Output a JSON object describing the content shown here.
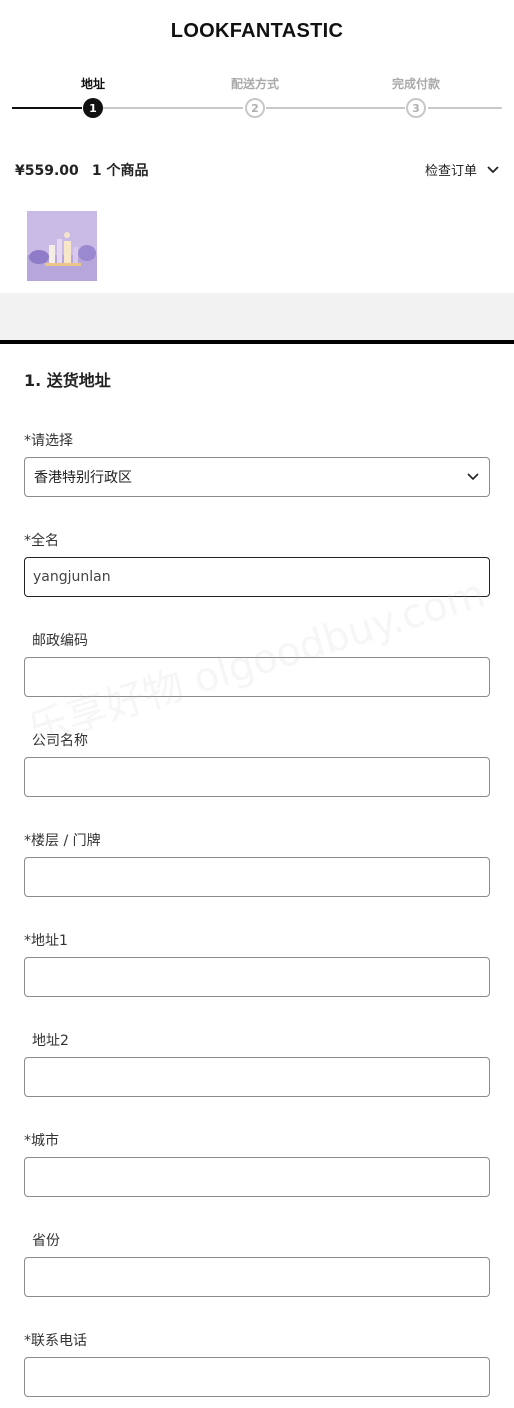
{
  "brand": "LOOKFANTASTIC",
  "steps": [
    {
      "label": "地址",
      "number": "1"
    },
    {
      "label": "配送方式",
      "number": "2"
    },
    {
      "label": "完成付款",
      "number": "3"
    }
  ],
  "summary": {
    "price": "¥559.00",
    "count": "1 个商品",
    "review_label": "检查订单"
  },
  "section_title": "1. 送货地址",
  "fields": {
    "region": {
      "label": "*请选择",
      "value": "香港特别行政区"
    },
    "fullname": {
      "label": "*全名",
      "value": "yangjunlan"
    },
    "postcode": {
      "label": "邮政编码",
      "value": ""
    },
    "company": {
      "label": "公司名称",
      "value": ""
    },
    "floor": {
      "label": "*楼层 / 门牌",
      "value": ""
    },
    "address1": {
      "label": "*地址1",
      "value": ""
    },
    "address2": {
      "label": "地址2",
      "value": ""
    },
    "city": {
      "label": "*城市",
      "value": ""
    },
    "province": {
      "label": "省份",
      "value": ""
    },
    "phone": {
      "label": "*联系电话",
      "value": ""
    }
  },
  "watermark": "乐享好物 olgoodbuy.com"
}
